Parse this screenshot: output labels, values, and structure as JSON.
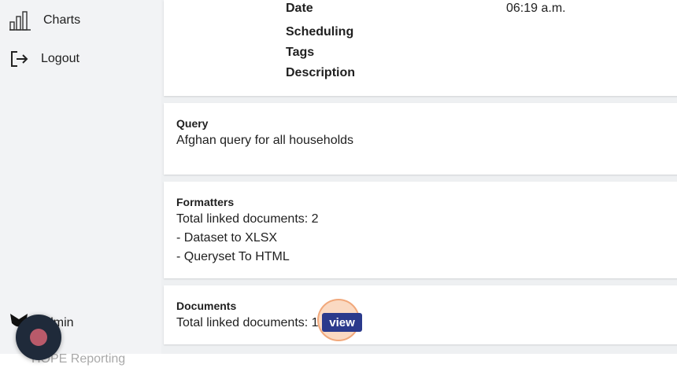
{
  "sidebar": {
    "items": [
      {
        "label": "Charts",
        "icon": "bar-chart-icon"
      },
      {
        "label": "Logout",
        "icon": "logout-icon"
      }
    ],
    "user": {
      "label": "admin",
      "icon": "user-badge-icon"
    },
    "brand": "HOPE Reporting"
  },
  "report": {
    "fields": [
      {
        "label": "Date",
        "value": "06:19 a.m."
      },
      {
        "label": "Scheduling",
        "value": ""
      },
      {
        "label": "Tags",
        "value": ""
      },
      {
        "label": "Description",
        "value": ""
      }
    ],
    "query": {
      "title": "Query",
      "text": "Afghan query for all households"
    },
    "formatters": {
      "title": "Formatters",
      "count_text": "Total linked documents: 2",
      "items": [
        "- Dataset to XLSX",
        "- Queryset To HTML"
      ]
    },
    "documents": {
      "title": "Documents",
      "count_text": "Total linked documents: 1",
      "view_label": "view"
    }
  },
  "colors": {
    "view_button": "#2b3a8c",
    "record_button": "#1f2a3a",
    "record_dot": "#b95a6a",
    "click_highlight": "#f5aa78"
  }
}
